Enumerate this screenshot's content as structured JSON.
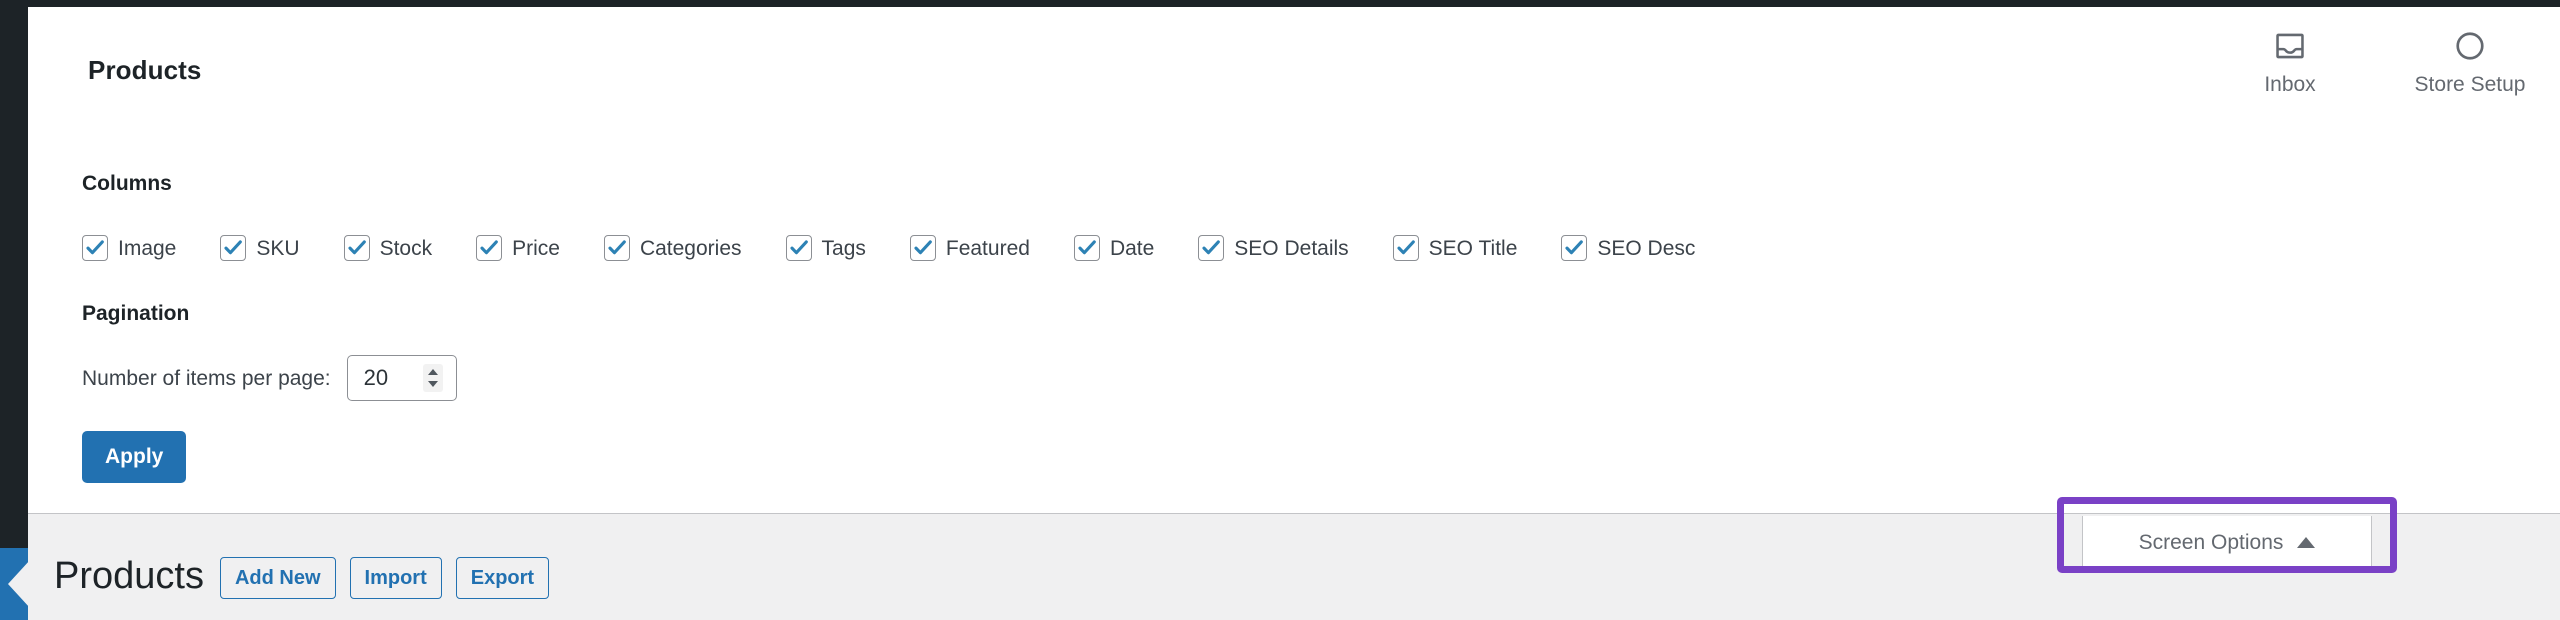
{
  "screen_options_panel": {
    "title": "Products",
    "activity_icons": [
      {
        "icon": "inbox-icon",
        "label": "Inbox"
      },
      {
        "icon": "store-setup-circle-icon",
        "label": "Store Setup"
      }
    ],
    "columns": {
      "legend": "Columns",
      "options": [
        {
          "label": "Image",
          "checked": true
        },
        {
          "label": "SKU",
          "checked": true
        },
        {
          "label": "Stock",
          "checked": true
        },
        {
          "label": "Price",
          "checked": true
        },
        {
          "label": "Categories",
          "checked": true
        },
        {
          "label": "Tags",
          "checked": true
        },
        {
          "label": "Featured",
          "checked": true
        },
        {
          "label": "Date",
          "checked": true
        },
        {
          "label": "SEO Details",
          "checked": true
        },
        {
          "label": "SEO Title",
          "checked": true
        },
        {
          "label": "SEO Desc",
          "checked": true
        }
      ]
    },
    "pagination": {
      "legend": "Pagination",
      "items_per_page_label": "Number of items per page:",
      "items_per_page_value": "20"
    },
    "apply_label": "Apply"
  },
  "screen_options_tab": {
    "label": "Screen Options",
    "caret": "triangle-up-icon"
  },
  "page_header": {
    "heading": "Products",
    "actions": [
      {
        "label": "Add New"
      },
      {
        "label": "Import"
      },
      {
        "label": "Export"
      }
    ]
  },
  "colors": {
    "admin_dark": "#1d2327",
    "accent_blue": "#2271b1",
    "checkbox_check": "#2d82b5",
    "annotation_purple": "#7a41c6",
    "panel_background": "#ffffff",
    "page_background": "#f0f0f1",
    "muted_text": "#646970"
  }
}
